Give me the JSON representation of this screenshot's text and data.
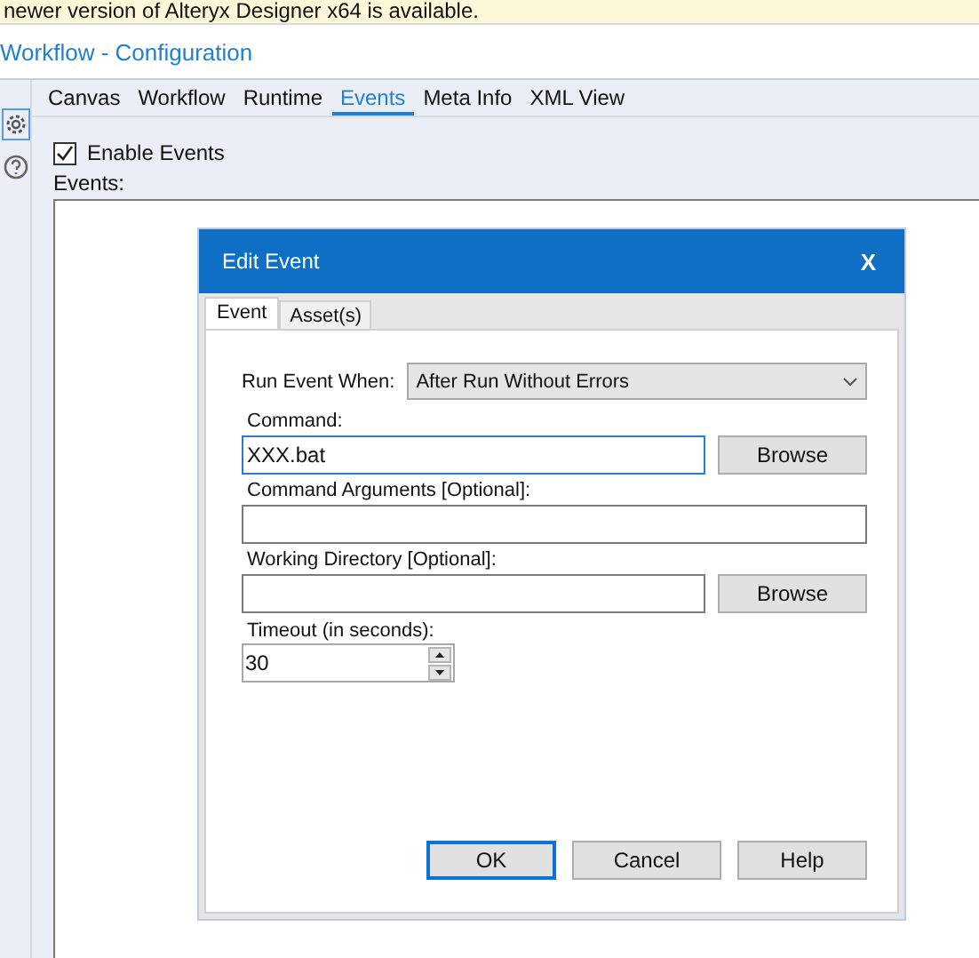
{
  "banner": {
    "text": "newer version of Alteryx Designer x64 is available."
  },
  "panel": {
    "title": "Workflow - Configuration"
  },
  "tabs": [
    {
      "label": "Canvas",
      "selected": false
    },
    {
      "label": "Workflow",
      "selected": false
    },
    {
      "label": "Runtime",
      "selected": false
    },
    {
      "label": "Events",
      "selected": true
    },
    {
      "label": "Meta Info",
      "selected": false
    },
    {
      "label": "XML View",
      "selected": false
    }
  ],
  "enable_events": {
    "label": "Enable Events",
    "checked": true
  },
  "events_label": "Events:",
  "dialog": {
    "title": "Edit Event",
    "close": "X",
    "tabs": [
      {
        "label": "Event",
        "selected": true
      },
      {
        "label": "Asset(s)",
        "selected": false
      }
    ],
    "run_event_when": {
      "label": "Run Event When:",
      "value": "After Run Without Errors"
    },
    "command": {
      "label": "Command:",
      "value": "XXX.bat",
      "button": "Browse"
    },
    "command_arguments": {
      "label": "Command Arguments [Optional]:"
    },
    "working_directory": {
      "label": "Working Directory [Optional]:",
      "button": "Browse"
    },
    "timeout": {
      "label": "Timeout (in seconds):",
      "value": "30"
    },
    "buttons": [
      {
        "label": "OK",
        "default": true
      },
      {
        "label": "Cancel",
        "default": false
      },
      {
        "label": "Help",
        "default": false
      }
    ]
  }
}
